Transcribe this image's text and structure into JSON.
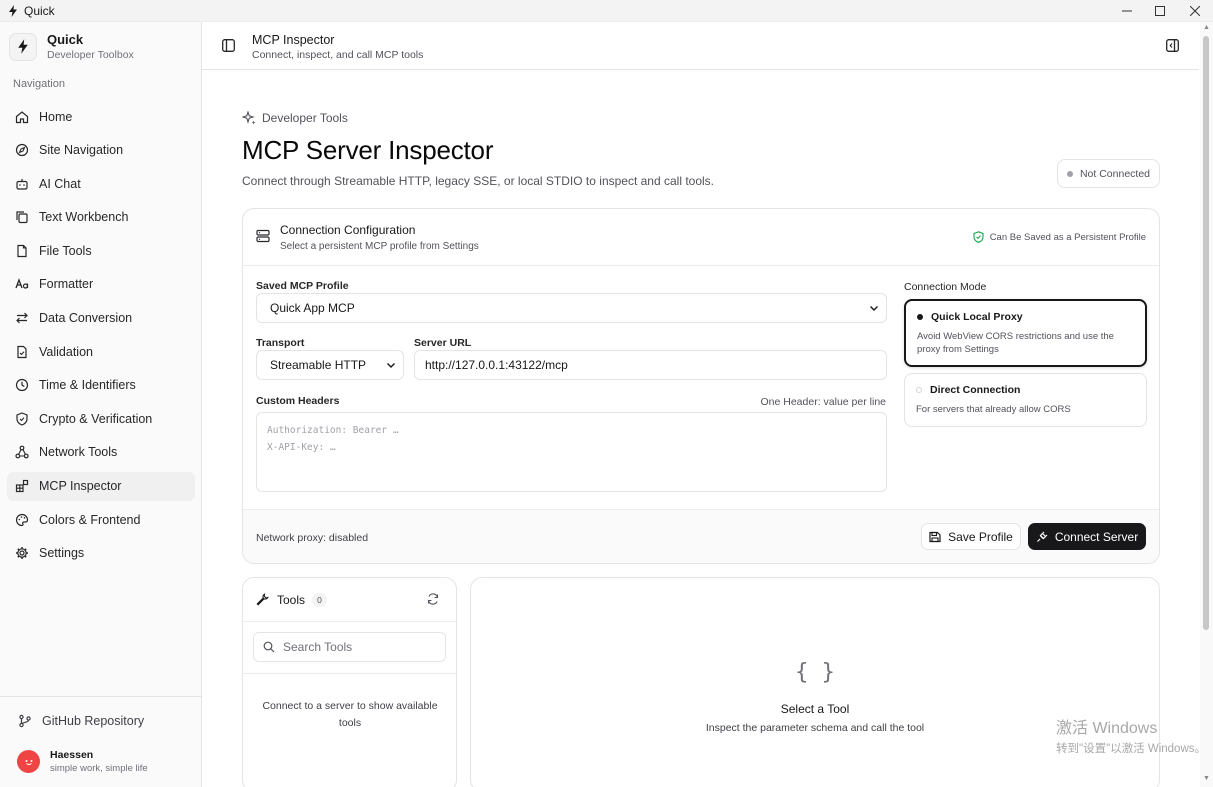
{
  "window": {
    "title": "Quick"
  },
  "brand": {
    "name": "Quick",
    "subtitle": "Developer Toolbox"
  },
  "sidebar": {
    "heading": "Navigation",
    "items": [
      {
        "label": "Home",
        "icon": "home-icon"
      },
      {
        "label": "Site Navigation",
        "icon": "compass-icon"
      },
      {
        "label": "AI Chat",
        "icon": "bot-icon"
      },
      {
        "label": "Text Workbench",
        "icon": "copy-icon"
      },
      {
        "label": "File Tools",
        "icon": "file-icon"
      },
      {
        "label": "Formatter",
        "icon": "text-case-icon"
      },
      {
        "label": "Data Conversion",
        "icon": "swap-arrows-icon"
      },
      {
        "label": "Validation",
        "icon": "file-check-icon"
      },
      {
        "label": "Time & Identifiers",
        "icon": "clock-icon"
      },
      {
        "label": "Crypto & Verification",
        "icon": "shield-icon"
      },
      {
        "label": "Network Tools",
        "icon": "network-icon"
      },
      {
        "label": "MCP Inspector",
        "icon": "blocks-icon"
      },
      {
        "label": "Colors & Frontend",
        "icon": "palette-icon"
      },
      {
        "label": "Settings",
        "icon": "gear-icon"
      }
    ],
    "active_index": 11,
    "github_label": "GitHub Repository",
    "user": {
      "name": "Haessen",
      "motto": "simple work, simple life"
    }
  },
  "header": {
    "title": "MCP Inspector",
    "subtitle": "Connect, inspect, and call MCP tools"
  },
  "page": {
    "eyebrow": "Developer Tools",
    "title": "MCP Server Inspector",
    "description": "Connect through Streamable HTTP, legacy SSE, or local STDIO to inspect and call tools.",
    "status": "Not Connected"
  },
  "config": {
    "title": "Connection Configuration",
    "subtitle": "Select a persistent MCP profile from Settings",
    "badge": "Can Be Saved as a Persistent Profile",
    "profile_label": "Saved MCP Profile",
    "profile_value": "Quick App MCP",
    "transport_label": "Transport",
    "transport_value": "Streamable HTTP",
    "url_label": "Server URL",
    "url_value": "http://127.0.0.1:43122/mcp",
    "headers_label": "Custom Headers",
    "headers_hint": "One Header: value per line",
    "headers_placeholder_1": "Authorization: Bearer …",
    "headers_placeholder_2": "X-API-Key: …",
    "mode_label": "Connection Mode",
    "modes": [
      {
        "title": "Quick Local Proxy",
        "desc": "Avoid WebView CORS restrictions and use the proxy from Settings",
        "selected": true
      },
      {
        "title": "Direct Connection",
        "desc": "For servers that already allow CORS",
        "selected": false
      }
    ],
    "proxy_status": "Network proxy: disabled",
    "save_label": "Save Profile",
    "connect_label": "Connect Server"
  },
  "tools": {
    "title": "Tools",
    "count": "0",
    "search_placeholder": "Search Tools",
    "empty_line1": "Connect to a server to show available",
    "empty_line2": "tools"
  },
  "detail": {
    "icon_text": "{ }",
    "title": "Select a Tool",
    "description": "Inspect the parameter schema and call the tool"
  },
  "watermark": {
    "line1": "激活 Windows",
    "line2": "转到\"设置\"以激活 Windows。"
  }
}
